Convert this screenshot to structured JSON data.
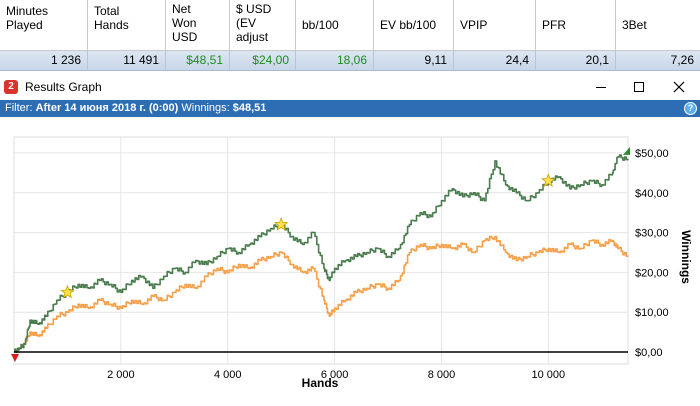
{
  "stats": {
    "headers": [
      "Minutes\nPlayed",
      "Total\nHands",
      "Net\nWon\nUSD",
      "$ USD\n(EV\nadjust",
      "bb/100",
      "EV bb/100",
      "VPIP",
      "PFR",
      "3Bet"
    ],
    "values": [
      "1 236",
      "11 491",
      "$48,51",
      "$24,00",
      "18,06",
      "9,11",
      "24,4",
      "20,1",
      "7,26"
    ]
  },
  "window": {
    "title": "Results Graph",
    "app_icon_letter": "2"
  },
  "filter": {
    "prefix": "Filter: ",
    "value": "After 14 июня 2018 г. (0:00)",
    "winnings_label": "Winnings: ",
    "winnings_value": "$48,51"
  },
  "chart_data": {
    "type": "line",
    "xlabel": "Hands",
    "ylabel": "Winnings",
    "xlim": [
      0,
      11491
    ],
    "ylim": [
      -3,
      54
    ],
    "x_ticks": [
      2000,
      4000,
      6000,
      8000,
      10000
    ],
    "x_tick_labels": [
      "2 000",
      "4 000",
      "6 000",
      "8 000",
      "10 000"
    ],
    "y_ticks": [
      0,
      10,
      20,
      30,
      40,
      50
    ],
    "y_tick_labels": [
      "$0,00",
      "$10,00",
      "$20,00",
      "$30,00",
      "$40,00",
      "$50,00"
    ],
    "grid": true,
    "colors": {
      "net_won": "#4a7c4e",
      "ev_adjusted": "#f5a04a",
      "zero_line": "#000000",
      "star": "#ffe14a"
    },
    "series": [
      {
        "key": "net_won",
        "x": [
          0,
          100,
          200,
          300,
          450,
          600,
          800,
          1000,
          1200,
          1400,
          1600,
          1800,
          2000,
          2200,
          2400,
          2600,
          2800,
          3000,
          3200,
          3400,
          3600,
          3800,
          4000,
          4200,
          4400,
          4600,
          4800,
          5000,
          5200,
          5400,
          5600,
          5800,
          5900,
          6000,
          6200,
          6400,
          6600,
          6800,
          7000,
          7200,
          7400,
          7600,
          7800,
          8000,
          8200,
          8400,
          8600,
          8800,
          9000,
          9200,
          9400,
          9600,
          9800,
          10000,
          10200,
          10400,
          10600,
          10800,
          11000,
          11200,
          11300,
          11491
        ],
        "y": [
          0,
          1,
          2,
          8,
          7,
          9,
          13,
          15,
          17,
          16,
          18,
          17,
          15,
          18,
          19,
          16,
          19,
          21,
          20,
          23,
          22,
          24,
          26,
          25,
          27,
          29,
          31,
          32,
          29,
          27,
          30,
          21,
          18,
          21,
          23,
          24,
          25,
          26,
          24,
          26,
          32,
          35,
          34,
          38,
          41,
          39,
          40,
          38,
          48,
          42,
          40,
          38,
          40,
          43,
          44,
          41,
          42,
          43,
          42,
          45,
          49,
          48.51
        ]
      },
      {
        "key": "ev_adjusted",
        "x": [
          0,
          100,
          200,
          300,
          450,
          600,
          800,
          1000,
          1200,
          1400,
          1600,
          1800,
          2000,
          2200,
          2400,
          2600,
          2800,
          3000,
          3200,
          3400,
          3600,
          3800,
          4000,
          4200,
          4400,
          4600,
          4800,
          5000,
          5200,
          5400,
          5600,
          5800,
          5900,
          6000,
          6200,
          6400,
          6600,
          6800,
          7000,
          7200,
          7400,
          7600,
          7800,
          8000,
          8200,
          8400,
          8600,
          8800,
          9000,
          9200,
          9400,
          9600,
          9800,
          10000,
          10200,
          10400,
          10600,
          10800,
          11000,
          11200,
          11300,
          11491
        ],
        "y": [
          0,
          1,
          2,
          5,
          4,
          6,
          9,
          10,
          12,
          11,
          13,
          12,
          11,
          13,
          12,
          14,
          13,
          15,
          17,
          16,
          19,
          21,
          20,
          22,
          21,
          23,
          24,
          25,
          22,
          20,
          21,
          13,
          9,
          11,
          13,
          15,
          16,
          17,
          16,
          18,
          25,
          27,
          26,
          27,
          26,
          27,
          25,
          28,
          29,
          25,
          23,
          24,
          25,
          26,
          25,
          27,
          26,
          28,
          27,
          28,
          26,
          24
        ]
      }
    ],
    "stars": [
      {
        "x": 1000,
        "y": 15
      },
      {
        "x": 5000,
        "y": 32
      },
      {
        "x": 10000,
        "y": 43
      }
    ]
  }
}
